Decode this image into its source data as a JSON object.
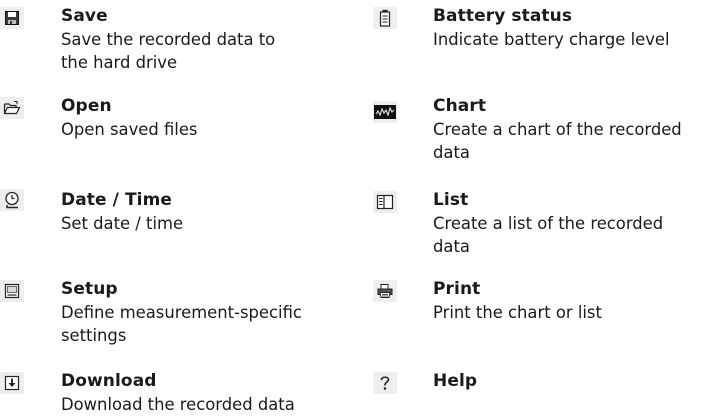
{
  "left_column": [
    {
      "icon": "save-icon",
      "title": "Save",
      "description": "Save the recorded data to the hard drive"
    },
    {
      "icon": "open-folder-icon",
      "title": "Open",
      "description": "Open saved files"
    },
    {
      "icon": "clock-icon",
      "title": "Date / Time",
      "description": "Set date / time"
    },
    {
      "icon": "setup-icon",
      "title": "Setup",
      "description": "Define measurement-specific settings"
    },
    {
      "icon": "download-icon",
      "title": "Download",
      "description": "Download the recorded data"
    }
  ],
  "right_column": [
    {
      "icon": "battery-icon",
      "title": "Battery status",
      "description": "Indicate battery charge level"
    },
    {
      "icon": "chart-icon",
      "title": "Chart",
      "description": "Create a chart of the recorded data"
    },
    {
      "icon": "list-icon",
      "title": "List",
      "description": "Create a list of the recorded data"
    },
    {
      "icon": "print-icon",
      "title": "Print",
      "description": "Print the chart or list"
    },
    {
      "icon": "help-icon",
      "title": "Help",
      "description": ""
    }
  ],
  "colors": {
    "text": "#1a1a1a",
    "icon_background": "#eeeeee",
    "icon_stroke": "#222222"
  }
}
